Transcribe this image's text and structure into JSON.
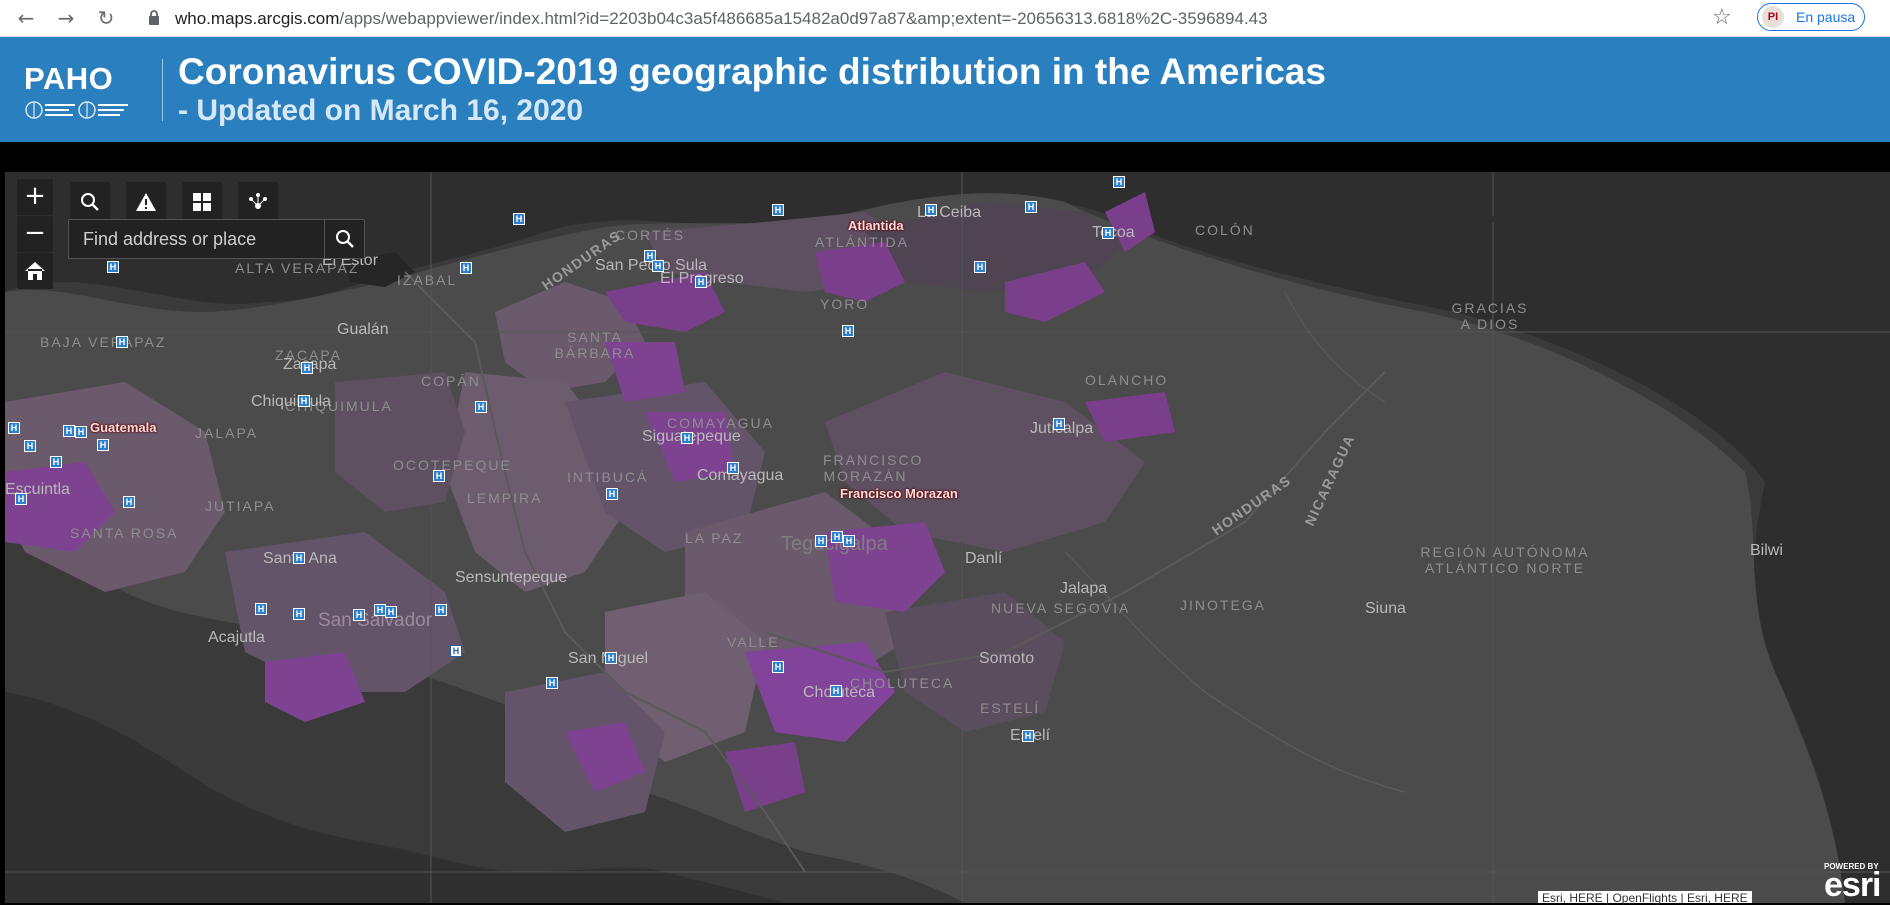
{
  "browser": {
    "url_host": "who.maps.arcgis.com",
    "url_path": "/apps/webappviewer/index.html?id=2203b04c3a5f486685a15482a0d97a87&amp;extent=-20656313.6818%2C-3596894.43",
    "profile_avatar": "PI",
    "profile_status": "En pausa"
  },
  "header": {
    "logo": "PAHO",
    "title": "Coronavirus COVID-2019 geographic distribution in the Americas",
    "subtitle": "- Updated on March 16, 2020"
  },
  "map": {
    "search_placeholder": "Find address or place",
    "cases": [
      {
        "name": "Atlantida"
      },
      {
        "name": "Guatemala"
      },
      {
        "name": "Francisco Morazan"
      }
    ],
    "labels": {
      "el_estor": "El Estor",
      "gualan": "Gualán",
      "zacapa": "Zacapa",
      "chiquimula": "Chiquimula",
      "san_pedro_sula": "San Pedro Sula",
      "el_progreso": "El Progreso",
      "la_ceiba": "La Ceiba",
      "tocoa": "Tocoa",
      "siguatepeque": "Siguatepeque",
      "comayagua": "Comayagua",
      "tegucigalpa": "Tegucigalpa",
      "danli": "Danlí",
      "jalapa": "Jalapa",
      "juticalpa": "Juticalpa",
      "san_salvador": "San Salvador",
      "santa_ana": "Santa Ana",
      "sensuntepeque": "Sensuntepeque",
      "acajutla": "Acajutla",
      "san_miguel": "San Miguel",
      "choluteca": "Choluteca",
      "somoto": "Somoto",
      "esteli": "Estelí",
      "siuna": "Siuna",
      "bilwi": "Bilwi",
      "juigalpa": "Jutiapa",
      "esquipulas": "Escuintla"
    },
    "regions": {
      "alta_verapaz": "ALTA VERAPAZ",
      "izabal": "IZABAL",
      "baja_verapaz": "BAJA VERAPAZ",
      "zacapa_r": "ZACAPA",
      "chiquimula_r": "CHIQUIMULA",
      "jalapa_r": "JALAPA",
      "jutiapa_r": "JUTIAPA",
      "santa_rosa": "SANTA ROSA",
      "cortes": "CORTÉS",
      "atlantida_r": "ATLÁNTIDA",
      "colon": "COLÓN",
      "yoro": "YORO",
      "santa_barbara": "SANTA BÁRBARA",
      "copan": "COPÁN",
      "ocotepeque": "OCOTEPEQUE",
      "lempira": "LEMPIRA",
      "intibuca": "INTIBUCÁ",
      "comayagua_r": "COMAYAGUA",
      "francisco_morazan_r": "FRANCISCO MORAZÁN",
      "la_paz": "LA PAZ",
      "olancho": "OLANCHO",
      "gracias_a_dios": "GRACIAS A DIOS",
      "valle": "VALLE",
      "choluteca_r": "CHOLUTECA",
      "nueva_segovia": "NUEVA SEGOVIA",
      "jinotega": "JINOTEGA",
      "estelí_r": "ESTELÍ",
      "raan": "REGIÓN AUTÓNOMA ATLÁNTICO NORTE"
    },
    "countries": {
      "honduras1": "HONDURAS",
      "honduras2": "HONDURAS",
      "nicaragua": "NICARAGUA"
    },
    "attribution": "Esri, HERE | OpenFlights | Esri, HERE",
    "esri_powered": "POWERED BY",
    "esri_logo": "esri"
  }
}
